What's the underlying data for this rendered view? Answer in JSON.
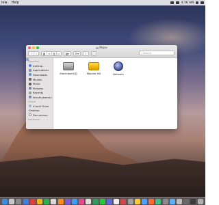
{
  "menubar": {
    "app_menu": "iew",
    "help_menu": "Help",
    "clock": "4:36 AM"
  },
  "window": {
    "title": "Mojav",
    "search_placeholder": "Search"
  },
  "sidebar": {
    "favorites_header": "Favorites",
    "favorites": [
      "AirDrop",
      "Applications",
      "Downloads",
      "Movies",
      "Music",
      "Pictures",
      "Recents",
      "timothykamau"
    ],
    "icloud_header": "iCloud",
    "icloud": [
      "iCloud Drive",
      "Desktop",
      "Documents"
    ],
    "locations_header": "Locations"
  },
  "content": {
    "items": [
      "MacintoshHD",
      "Mojave HD",
      "Network"
    ]
  },
  "dock": {
    "icon_colors": [
      "#3a8ee6",
      "#c8c8c8",
      "#8a8a8a",
      "#3f7fe0",
      "#e33c3c",
      "#f2b31b",
      "#2bb24c",
      "#d9d9d9",
      "#ff8c1a",
      "#7a5cd6",
      "#3aa0ff",
      "#e84b8a",
      "#e0e0e0",
      "#2f9e5b",
      "#28c840",
      "#5a6cd9",
      "#f0f0f0",
      "#d64545",
      "#a0a0a0",
      "#ffcc33",
      "#4da3ff",
      "#ff6b35",
      "#3fbf7f",
      "#8c8c8c",
      "#5ab2ff",
      "#c0c0c0",
      "#6a6a6a",
      "#3a3a3a",
      "#b0b0b0"
    ]
  }
}
